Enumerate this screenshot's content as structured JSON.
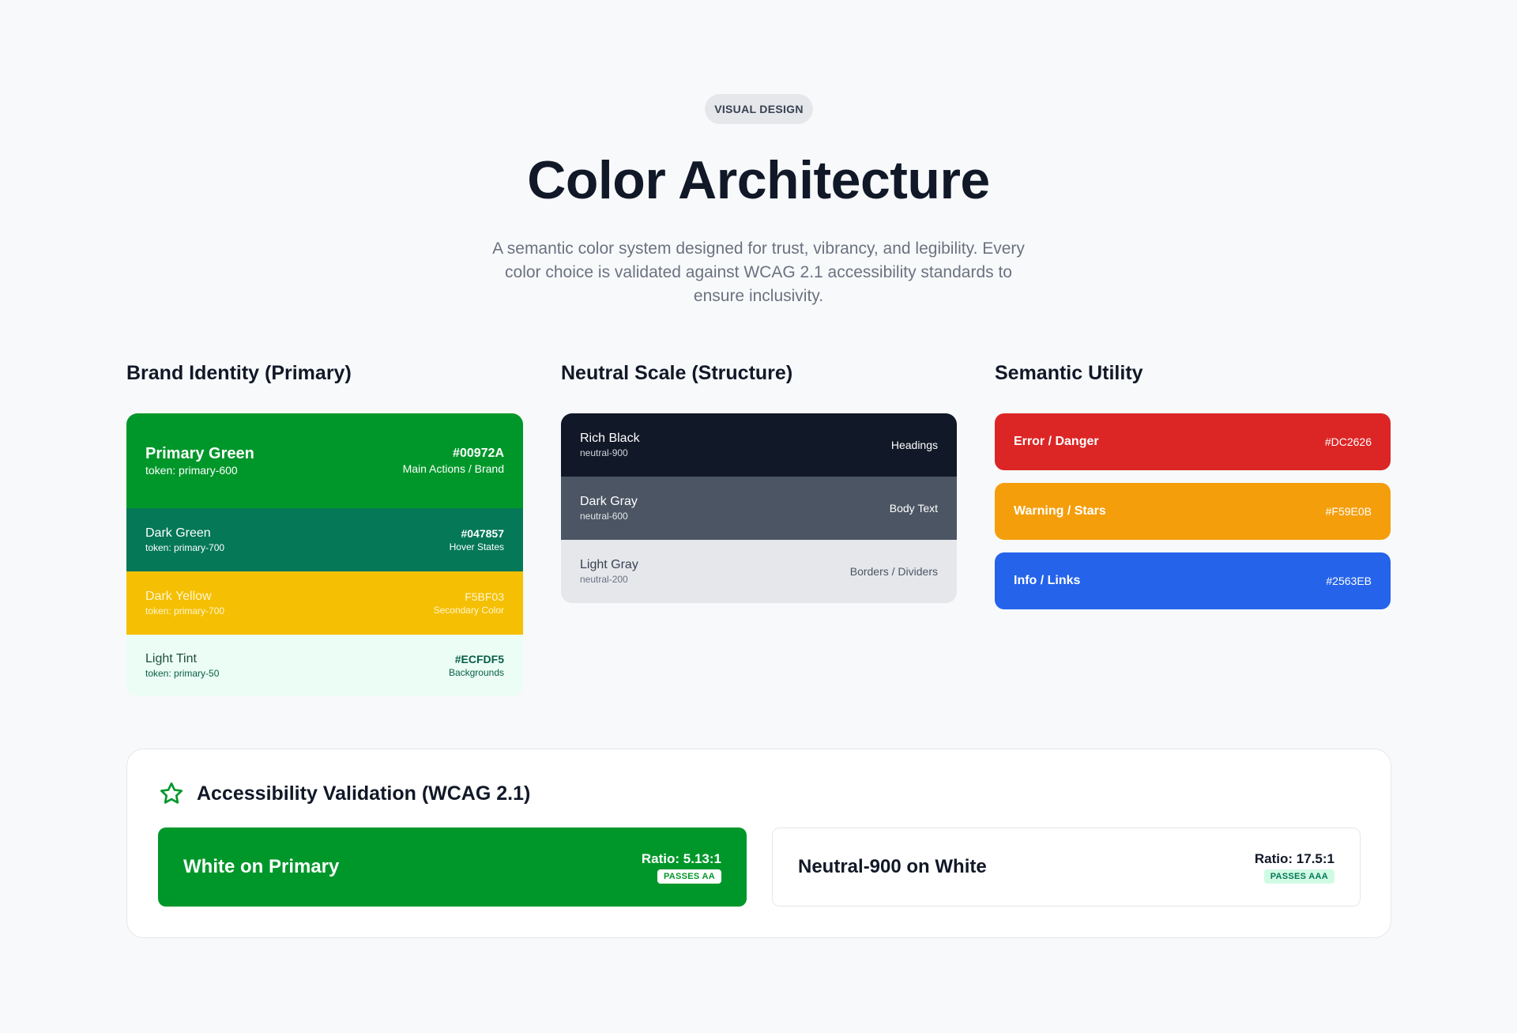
{
  "header": {
    "badge": "VISUAL DESIGN",
    "title": "Color Architecture",
    "subtitle": "A semantic color system designed for trust, vibrancy, and legibility. Every color choice is validated against WCAG 2.1 accessibility standards to ensure inclusivity."
  },
  "columns": {
    "brand_title": "Brand Identity (Primary)",
    "neutral_title": "Neutral Scale (Structure)",
    "semantic_title": "Semantic Utility"
  },
  "brand": [
    {
      "name": "Primary Green",
      "token": "token: primary-600",
      "hex": "#00972A",
      "use": "Main Actions / Brand",
      "color": "#00972A"
    },
    {
      "name": "Dark Green",
      "token": "token: primary-700",
      "hex": "#047857",
      "use": "Hover States",
      "color": "#047857"
    },
    {
      "name": "Dark Yellow",
      "token": "token: primary-700",
      "hex": "F5BF03",
      "use": "Secondary Color",
      "color": "#F5BF03"
    },
    {
      "name": "Light Tint",
      "token": "token: primary-50",
      "hex": "#ECFDF5",
      "use": "Backgrounds",
      "color": "#ECFDF5"
    }
  ],
  "neutral": [
    {
      "name": "Rich Black",
      "token": "neutral-900",
      "use": "Headings",
      "color": "#111827"
    },
    {
      "name": "Dark Gray",
      "token": "neutral-600",
      "use": "Body Text",
      "color": "#4B5563"
    },
    {
      "name": "Light Gray",
      "token": "neutral-200",
      "use": "Borders / Dividers",
      "color": "#E5E7EB"
    }
  ],
  "semantic": [
    {
      "label": "Error / Danger",
      "hex": "#DC2626",
      "color": "#DC2626"
    },
    {
      "label": "Warning / Stars",
      "hex": "#F59E0B",
      "color": "#F59E0B"
    },
    {
      "label": "Info / Links",
      "hex": "#2563EB",
      "color": "#2563EB"
    }
  ],
  "accessibility": {
    "icon": "star-outline-icon",
    "title": "Accessibility Validation (WCAG 2.1)",
    "tests": [
      {
        "label": "White on Primary",
        "ratio": "Ratio: 5.13:1",
        "result": "PASSES AA"
      },
      {
        "label": "Neutral-900 on White",
        "ratio": "Ratio: 17.5:1",
        "result": "PASSES AAA"
      }
    ]
  }
}
